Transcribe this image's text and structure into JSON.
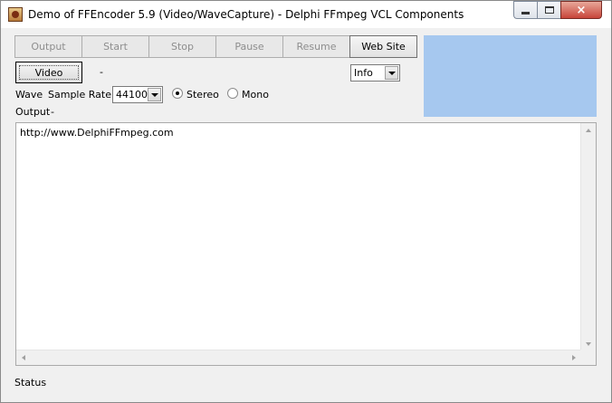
{
  "window": {
    "title": "Demo of FFEncoder 5.9 (Video/WaveCapture) - Delphi FFmpeg VCL Components",
    "caption_buttons": {
      "minimize": "minimize-icon",
      "maximize": "maximize-icon",
      "close": "×"
    }
  },
  "toolbar": {
    "buttons": [
      {
        "label": "Output",
        "enabled": false
      },
      {
        "label": "Start",
        "enabled": false
      },
      {
        "label": "Stop",
        "enabled": false
      },
      {
        "label": "Pause",
        "enabled": false
      },
      {
        "label": "Resume",
        "enabled": false
      },
      {
        "label": "Web Site",
        "enabled": true
      }
    ]
  },
  "video": {
    "button_label": "Video",
    "value": "-"
  },
  "log_level": {
    "selected": "Info"
  },
  "wave": {
    "label": "Wave",
    "sample_rate_label": "Sample Rate",
    "sample_rate": "44100",
    "channel_options": [
      {
        "label": "Stereo",
        "checked": true
      },
      {
        "label": "Mono",
        "checked": false
      }
    ]
  },
  "output": {
    "label": "Output",
    "value": "-"
  },
  "memo": {
    "text": "http://www.DelphiFFmpeg.com"
  },
  "status": {
    "text": "Status"
  },
  "colors": {
    "preview_bg": "#a6c8ef",
    "window_bg": "#f0f0f0"
  }
}
